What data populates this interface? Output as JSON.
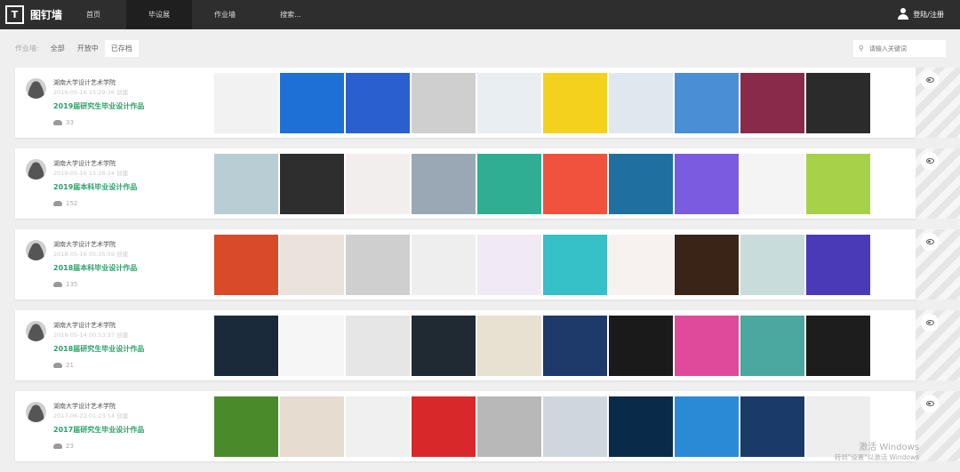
{
  "header": {
    "logo_text": "图钉墙",
    "logo_icon": "pin-icon",
    "nav": [
      {
        "label": "首页"
      },
      {
        "label": "毕设展",
        "active": true
      },
      {
        "label": "作业墙"
      },
      {
        "label": "搜索..."
      }
    ],
    "login": "登陆/注册"
  },
  "filter": {
    "label": "作业墙:",
    "options": [
      "全部",
      "开放中",
      "已存档"
    ],
    "active": "已存档"
  },
  "search": {
    "placeholder": "请输入关键词"
  },
  "rows": [
    {
      "org": "湖南大学设计艺术学院",
      "date": "2019-05-16 15:29:36 创建",
      "title": "2019届研究生毕业设计作品",
      "count": "33",
      "thumbs": [
        "#f2f2f2",
        "#1e6fd6",
        "#2a5fd0",
        "#cfcfcf",
        "#e9eef3",
        "#f3d21e",
        "#dfe8ee",
        "#4a8fd6",
        "#8a2a4a",
        "#2b2b2b"
      ]
    },
    {
      "org": "湖南大学设计艺术学院",
      "date": "2019-05-16 15:26:24 创建",
      "title": "2019届本科毕业设计作品",
      "count": "152",
      "thumbs": [
        "#b8cdd4",
        "#2e2e2e",
        "#f3eeee",
        "#9aa8b5",
        "#2fae93",
        "#f0523e",
        "#1f6fa0",
        "#7a5ce0",
        "#f4f4f4",
        "#a8d14a"
      ]
    },
    {
      "org": "湖南大学设计艺术学院",
      "date": "2018-05-16 05:35:59 创建",
      "title": "2018届本科毕业设计作品",
      "count": "135",
      "thumbs": [
        "#d94a28",
        "#eae3dc",
        "#cfcfcf",
        "#eeeeee",
        "#f1eaf4",
        "#36c0c8",
        "#f7f2f0",
        "#3a2418",
        "#c8dcdc",
        "#4a3ab8"
      ]
    },
    {
      "org": "湖南大学设计艺术学院",
      "date": "2018-05-14 00:53:37 创建",
      "title": "2018届研究生毕业设计作品",
      "count": "21",
      "thumbs": [
        "#1a2a3a",
        "#f6f6f6",
        "#e6e6e6",
        "#1f2a33",
        "#e8e0d0",
        "#1e3a6a",
        "#1a1a1a",
        "#e04a9a",
        "#4aa8a0",
        "#1d1d1d"
      ]
    },
    {
      "org": "湖南大学设计艺术学院",
      "date": "2017-06-22 01:23:14 创建",
      "title": "2017届研究生毕业设计作品",
      "count": "23",
      "thumbs": [
        "#4a8a2a",
        "#e6dcd0",
        "#f0f0f0",
        "#d8282a",
        "#b8b8b8",
        "#cfd6de",
        "#0a2a4a",
        "#2a8ad6",
        "#1a3a6a",
        "#eeeeee"
      ]
    }
  ],
  "watermark": {
    "line1": "激活 Windows",
    "line2": "转到\"设置\"以激活 Windows"
  }
}
